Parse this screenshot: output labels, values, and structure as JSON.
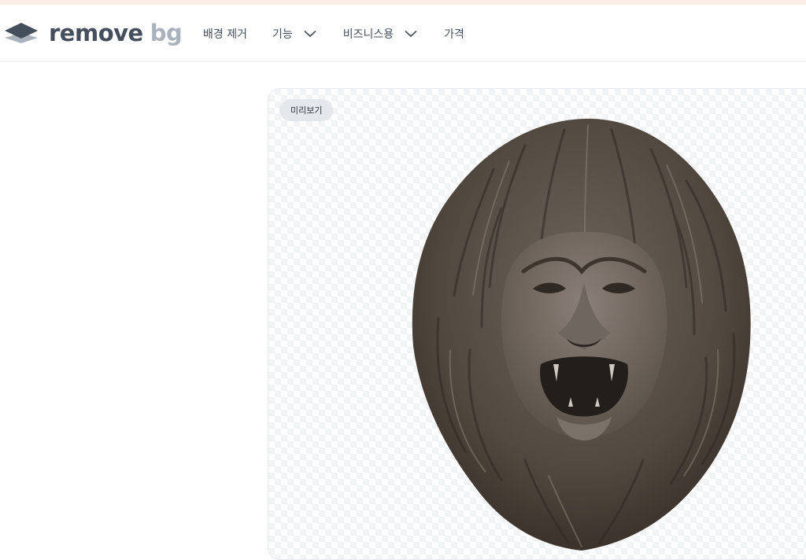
{
  "header": {
    "logo": {
      "word": "remove",
      "suffix": "bg",
      "icon": "layers-logo-icon"
    },
    "nav": [
      {
        "label": "배경 제거",
        "has_dropdown": false
      },
      {
        "label": "기능",
        "has_dropdown": true,
        "icon": "chevron-down-icon"
      },
      {
        "label": "비즈니스용",
        "has_dropdown": true,
        "icon": "chevron-down-icon"
      },
      {
        "label": "가격",
        "has_dropdown": false
      }
    ]
  },
  "preview": {
    "badge": "미리보기",
    "image": "lion-head-sculpture",
    "background": "transparent-checkerboard"
  },
  "colors": {
    "brand_dark": "#454f5b",
    "brand_light": "#aab2bc",
    "badge_bg": "#e4e7eb"
  }
}
